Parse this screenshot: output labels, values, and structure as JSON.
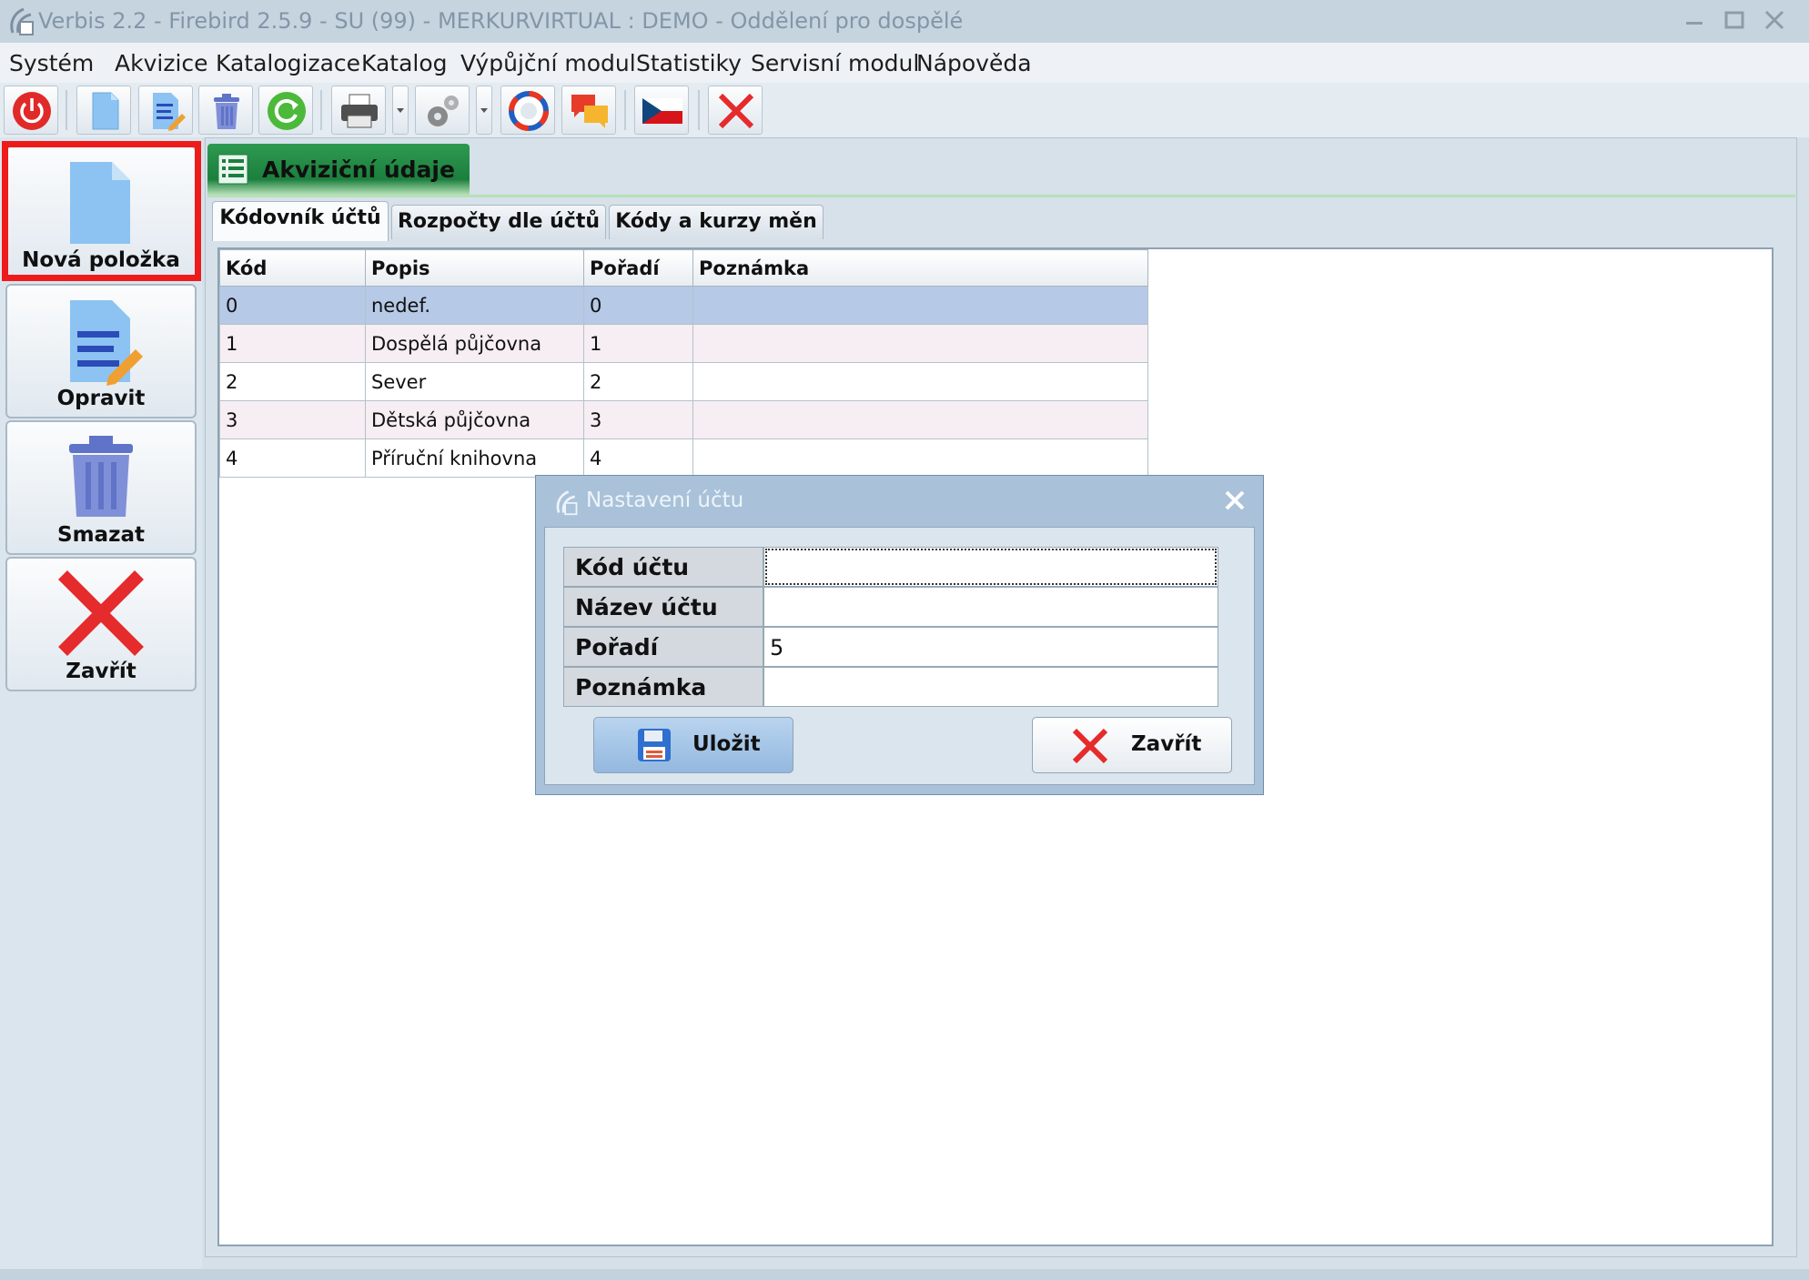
{
  "window": {
    "title": "Verbis 2.2 - Firebird 2.5.9 - SU (99) - MERKURVIRTUAL : DEMO - Oddělení pro dospělé"
  },
  "menu": [
    "Systém",
    "Akvizice",
    "Katalogizace",
    "Katalog",
    "Výpůjční modul",
    "Statistiky",
    "Servisní modul",
    "Nápověda"
  ],
  "toolbar": {
    "icons": [
      "power-icon",
      "new-document-icon",
      "edit-document-icon",
      "trash-icon",
      "refresh-icon",
      "printer-icon",
      "settings-gear-icon",
      "lifebuoy-icon",
      "chat-icon",
      "czech-flag-icon",
      "close-icon"
    ]
  },
  "side": {
    "new_label": "Nová položka",
    "edit_label": "Opravit",
    "delete_label": "Smazat",
    "close_label": "Zavřít"
  },
  "main_tab": {
    "label": "Akviziční údaje"
  },
  "subtabs": [
    "Kódovník účtů",
    "Rozpočty dle účtů",
    "Kódy a kurzy měn"
  ],
  "table": {
    "columns": [
      "Kód",
      "Popis",
      "Pořadí",
      "Poznámka"
    ],
    "rows": [
      [
        "0",
        "nedef.",
        "0",
        ""
      ],
      [
        "1",
        "Dospělá půjčovna",
        "1",
        ""
      ],
      [
        "2",
        "Sever",
        "2",
        ""
      ],
      [
        "3",
        "Dětská půjčovna",
        "3",
        ""
      ],
      [
        "4",
        "Příruční knihovna",
        "4",
        ""
      ]
    ],
    "selected_row": 0
  },
  "dialog": {
    "title": "Nastavení účtu",
    "fields": [
      {
        "label": "Kód účtu",
        "value": ""
      },
      {
        "label": "Název účtu",
        "value": ""
      },
      {
        "label": "Pořadí",
        "value": "5"
      },
      {
        "label": "Poznámka",
        "value": ""
      }
    ],
    "save_label": "Uložit",
    "close_label": "Zavřít"
  },
  "colors": {
    "highlight": "#ee1b1b",
    "tab_green": "#1b7f3e",
    "selected_row": "#b6c9e6",
    "alt_row": "#f6eef2"
  }
}
